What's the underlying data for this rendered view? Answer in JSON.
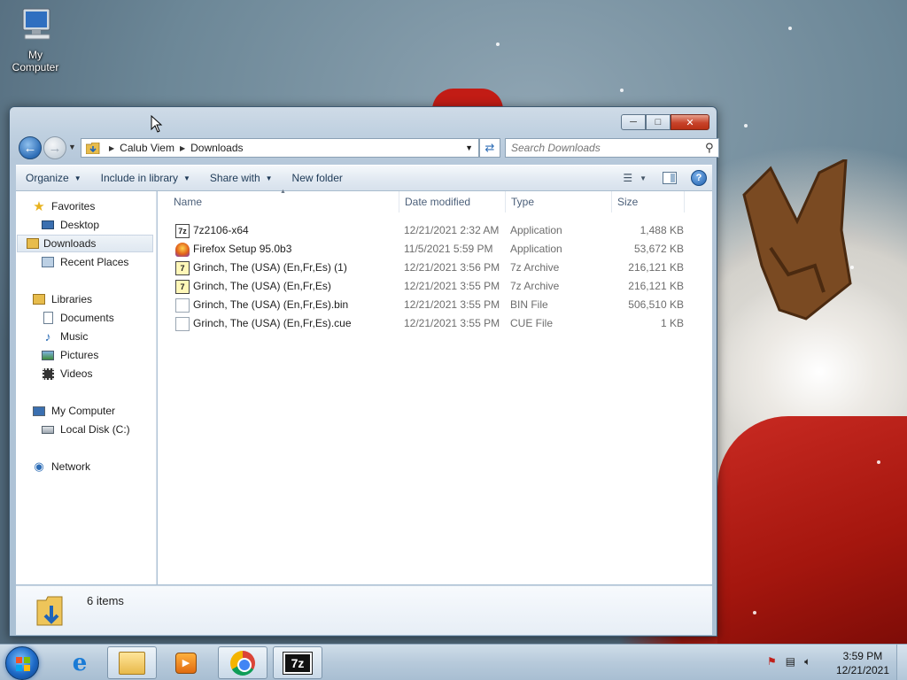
{
  "desktop": {
    "icon_label": "My Computer"
  },
  "window": {
    "address": {
      "crumbs": [
        "Calub Viem",
        "Downloads"
      ]
    },
    "search": {
      "placeholder": "Search Downloads"
    },
    "commands": {
      "organize": "Organize",
      "include_in_library": "Include in library",
      "share_with": "Share with",
      "new_folder": "New folder"
    },
    "nav": {
      "favorites": "Favorites",
      "desktop": "Desktop",
      "downloads": "Downloads",
      "recent_places": "Recent Places",
      "libraries": "Libraries",
      "documents": "Documents",
      "music": "Music",
      "pictures": "Pictures",
      "videos": "Videos",
      "my_computer": "My Computer",
      "local_disk": "Local Disk (C:)",
      "network": "Network"
    },
    "columns": {
      "name": "Name",
      "date_modified": "Date modified",
      "type": "Type",
      "size": "Size"
    },
    "files": [
      {
        "name": "7z2106-x64",
        "date": "12/21/2021 2:32 AM",
        "type": "Application",
        "size": "1,488 KB",
        "icon": "7zip-app-icon"
      },
      {
        "name": "Firefox Setup 95.0b3",
        "date": "11/5/2021 5:59 PM",
        "type": "Application",
        "size": "53,672 KB",
        "icon": "firefox-setup-icon"
      },
      {
        "name": "Grinch, The (USA) (En,Fr,Es) (1)",
        "date": "12/21/2021 3:56 PM",
        "type": "7z Archive",
        "size": "216,121 KB",
        "icon": "7z-archive-icon"
      },
      {
        "name": "Grinch, The (USA) (En,Fr,Es)",
        "date": "12/21/2021 3:55 PM",
        "type": "7z Archive",
        "size": "216,121 KB",
        "icon": "7z-archive-icon"
      },
      {
        "name": "Grinch, The (USA) (En,Fr,Es).bin",
        "date": "12/21/2021 3:55 PM",
        "type": "BIN File",
        "size": "506,510 KB",
        "icon": "file-icon"
      },
      {
        "name": "Grinch, The (USA) (En,Fr,Es).cue",
        "date": "12/21/2021 3:55 PM",
        "type": "CUE File",
        "size": "1 KB",
        "icon": "file-icon"
      }
    ],
    "details": {
      "item_count": "6 items"
    }
  },
  "taskbar": {
    "clock": {
      "time": "3:59 PM",
      "date": "12/21/2021"
    }
  }
}
